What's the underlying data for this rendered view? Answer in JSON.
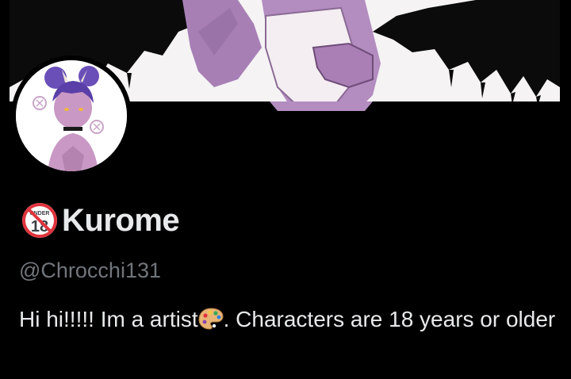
{
  "profile": {
    "display_name": "Kurome",
    "badge_icon": "under-18-icon",
    "badge_text": "UNDER",
    "badge_number": "18",
    "handle": "@Chrocchi131",
    "bio_before_icon": "Hi hi!!!!! Im a artist",
    "bio_icon": "artist-palette-icon",
    "bio_after_icon": ". Characters are 18 years or older"
  },
  "colors": {
    "background": "#000000",
    "primary_text": "#e7e9ea",
    "secondary_text": "#71767b",
    "badge_red": "#e0343e",
    "badge_gray": "#3b3f45"
  }
}
